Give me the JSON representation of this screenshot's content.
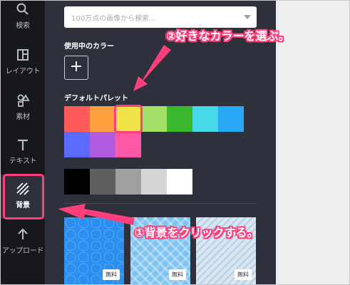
{
  "rail": {
    "items": [
      {
        "label": "検索",
        "icon": "search-icon"
      },
      {
        "label": "レイアウト",
        "icon": "layout-icon"
      },
      {
        "label": "素材",
        "icon": "elements-icon"
      },
      {
        "label": "テキスト",
        "icon": "text-icon"
      },
      {
        "label": "背景",
        "icon": "background-icon",
        "active": true
      },
      {
        "label": "アップロード",
        "icon": "upload-icon"
      }
    ]
  },
  "panel": {
    "search_placeholder": "100万点の画像から検索...",
    "used_colors_title": "使用中のカラー",
    "add_color_label": "+",
    "default_palette_title": "デフォルトパレット",
    "palette_row1": [
      "#ff5a5a",
      "#ff9f40",
      "#f2e24a",
      "#a3e06a",
      "#3bb82e",
      "#45d8e6",
      "#2aa8f5"
    ],
    "palette_row2": [
      "#5b6bff",
      "#b05be0",
      "#ff5aa8"
    ],
    "selected_color": "#f2e24a",
    "grays": [
      "#000000",
      "#5f5f5f",
      "#a0a0a0",
      "#d6d6d6",
      "#ffffff"
    ],
    "backgrounds": [
      {
        "pattern": "hexagon",
        "badge": "無料"
      },
      {
        "pattern": "chevron",
        "badge": "無料"
      },
      {
        "pattern": "diagonal",
        "badge": "無料"
      }
    ]
  },
  "annotations": {
    "step1": "①背景をクリックする。",
    "step2": "②好きなカラーを選ぶ。",
    "accent": "#ff3f7c"
  }
}
